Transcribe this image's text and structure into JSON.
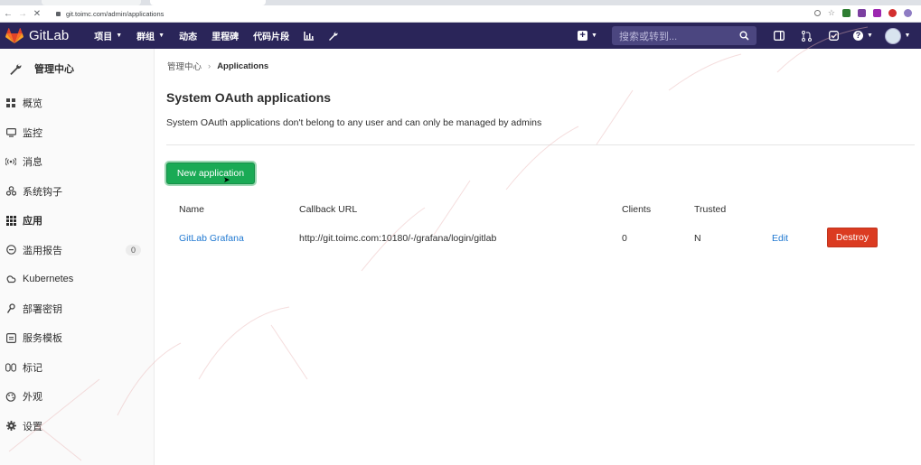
{
  "browser": {
    "url": "git.toimc.com/admin/applications"
  },
  "header": {
    "brand": "GitLab",
    "nav": [
      {
        "label": "项目",
        "has_caret": true
      },
      {
        "label": "群组",
        "has_caret": true
      },
      {
        "label": "动态",
        "has_caret": false
      },
      {
        "label": "里程碑",
        "has_caret": false
      },
      {
        "label": "代码片段",
        "has_caret": false
      }
    ],
    "search_placeholder": "搜索或转到...",
    "brand_color": "#2a2559"
  },
  "sidebar": {
    "title": "管理中心",
    "items": [
      {
        "label": "概览",
        "icon": "overview-icon"
      },
      {
        "label": "监控",
        "icon": "monitor-icon"
      },
      {
        "label": "消息",
        "icon": "broadcast-icon"
      },
      {
        "label": "系统钩子",
        "icon": "hook-icon"
      },
      {
        "label": "应用",
        "icon": "apps-grid-icon",
        "active": true
      },
      {
        "label": "滥用报告",
        "icon": "abuse-report-icon",
        "badge": "0"
      },
      {
        "label": "Kubernetes",
        "icon": "kubernetes-icon"
      },
      {
        "label": "部署密钥",
        "icon": "key-icon"
      },
      {
        "label": "服务模板",
        "icon": "template-icon"
      },
      {
        "label": "标记",
        "icon": "labels-icon"
      },
      {
        "label": "外观",
        "icon": "appearance-icon"
      },
      {
        "label": "设置",
        "icon": "settings-gear-icon"
      }
    ]
  },
  "breadcrumb": {
    "parent": "管理中心",
    "current": "Applications"
  },
  "page": {
    "title": "System OAuth applications",
    "description": "System OAuth applications don't belong to any user and can only be managed by admins",
    "new_button": "New application"
  },
  "table": {
    "headers": {
      "name": "Name",
      "callback": "Callback URL",
      "clients": "Clients",
      "trusted": "Trusted"
    },
    "rows": [
      {
        "name": "GitLab Grafana",
        "callback": "http://git.toimc.com:10180/-/grafana/login/gitlab",
        "clients": "0",
        "trusted": "N",
        "edit": "Edit",
        "destroy": "Destroy"
      }
    ]
  },
  "colors": {
    "primary_button": "#1aaa55",
    "danger_button": "#db3b21",
    "link": "#1f78d1"
  }
}
